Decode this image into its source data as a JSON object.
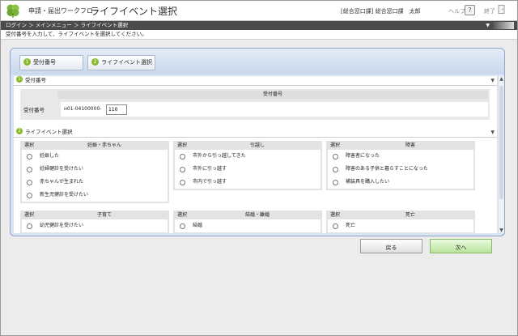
{
  "header": {
    "app_name": "申請・届出ワークフロー",
    "page_title": "ライフイベント選択",
    "user_info": "[総合窓口課] 総合窓口課　太郎",
    "help_label": "ヘルプ",
    "help_icon_text": "?",
    "exit_label": "終了"
  },
  "breadcrumb": {
    "path": "ログイン ＞ メインメニュー ＞ ライフイベント選択",
    "arrow": "▼"
  },
  "instruction": "受付番号を入力して、ライフイベントを選択してください。",
  "steps": [
    {
      "num": "1",
      "label": "受付番号"
    },
    {
      "num": "2",
      "label": "ライフイベント選択"
    }
  ],
  "section_reception": {
    "num": "1",
    "title": "受付番号",
    "toggle": "▼",
    "column_header": "受付番号",
    "row_label": "受付番号",
    "prefix": "н01-04100000-",
    "input_value": "110"
  },
  "section_events": {
    "num": "2",
    "title": "ライフイベント選択",
    "toggle": "▼",
    "select_header": "選択",
    "categories": [
      {
        "title": "妊娠・赤ちゃん",
        "options": [
          "妊娠した",
          "妊婦健診を受けたい",
          "赤ちゃんが生まれた",
          "新生児健診を受けたい"
        ]
      },
      {
        "title": "引越し",
        "options": [
          "市外から引っ越してきた",
          "市外に引っ越す",
          "市内で引っ越す"
        ]
      },
      {
        "title": "障害",
        "options": [
          "障害者になった",
          "障害のある子供と暮らすことになった",
          "補装具を購入したい"
        ]
      },
      {
        "title": "子育て",
        "options": [
          "幼児健診を受けたい"
        ]
      },
      {
        "title": "結婚・離婚",
        "options": [
          "結婚"
        ]
      },
      {
        "title": "死亡",
        "options": [
          "死亡"
        ]
      }
    ]
  },
  "scrollbar": {
    "up": "▲",
    "down": "▼"
  },
  "footer": {
    "back_label": "戻る",
    "next_label": "次へ"
  }
}
